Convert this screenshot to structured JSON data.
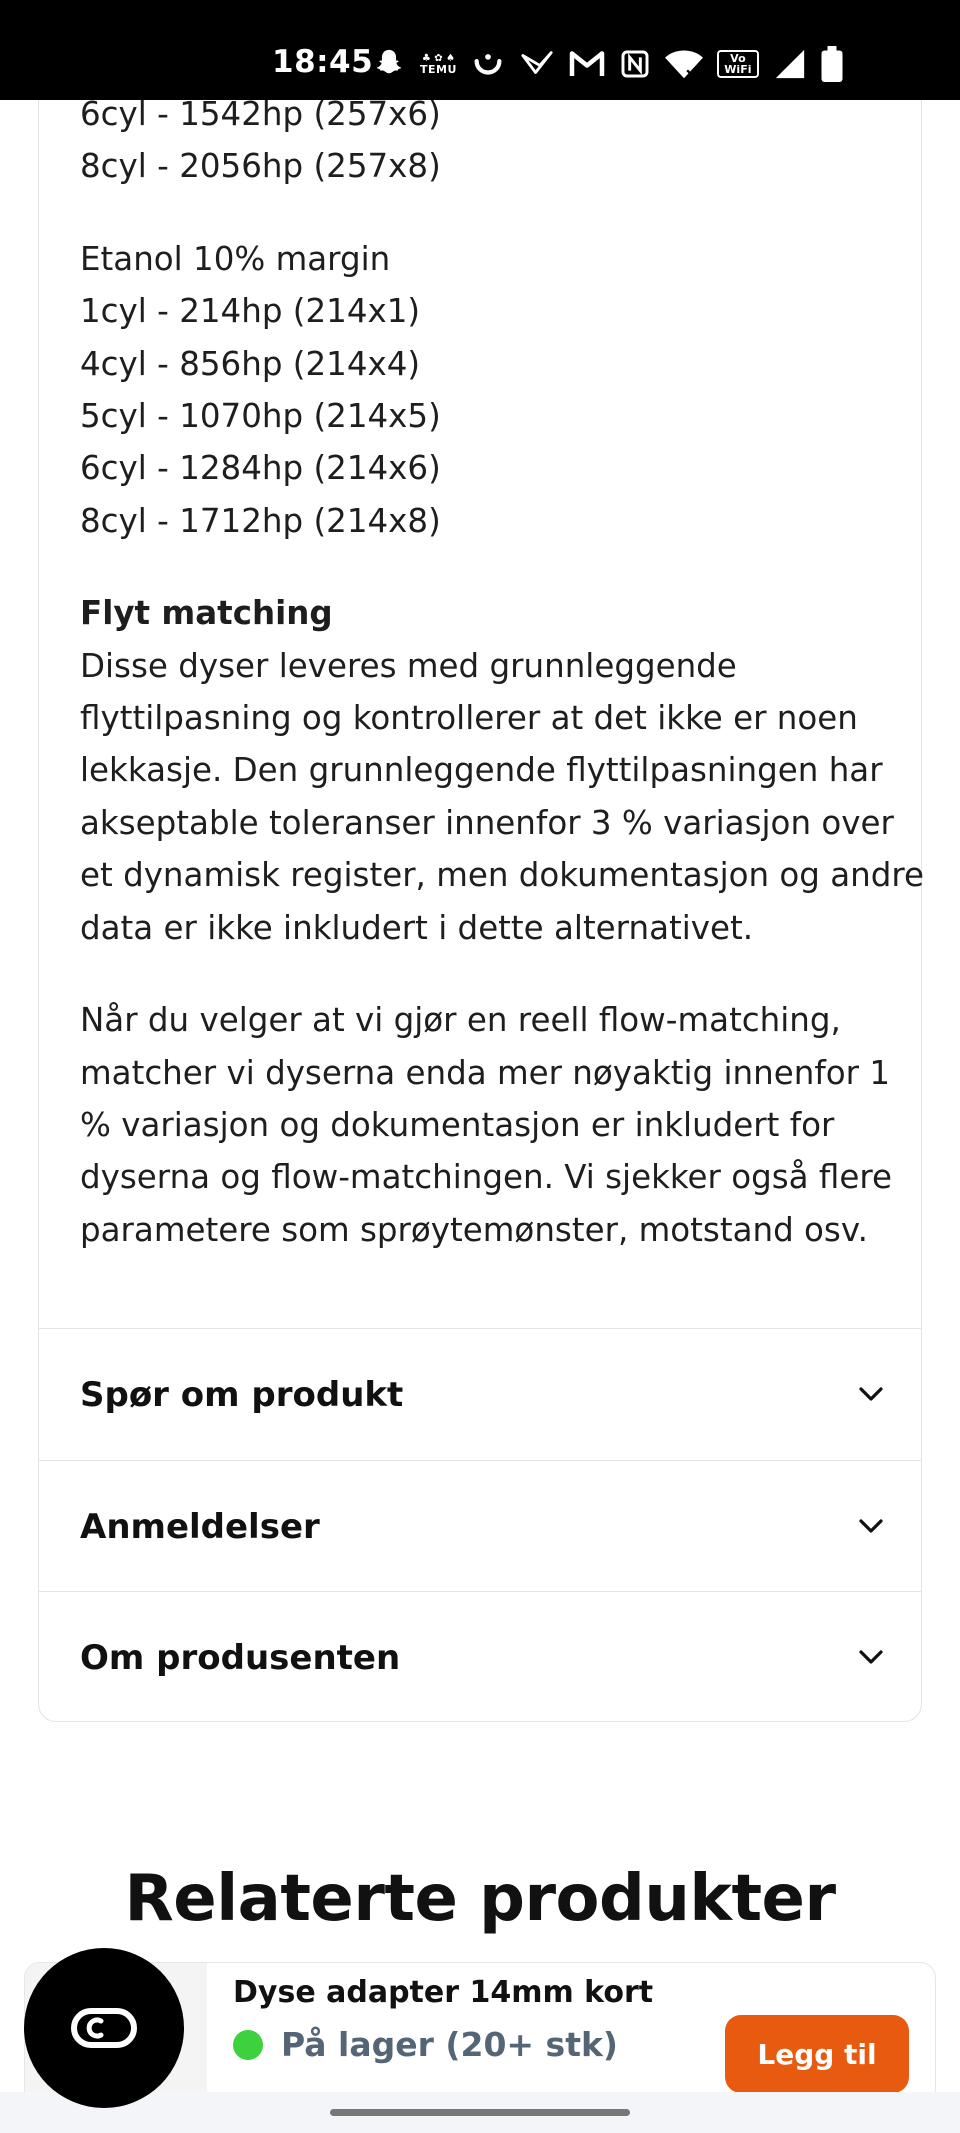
{
  "status_bar": {
    "time": "18:45",
    "icons": [
      "snapchat-icon",
      "temu-icon",
      "smile-app-icon",
      "bird-app-icon",
      "gmail-icon",
      "nfc-icon",
      "wifi-icon",
      "vowifi-icon",
      "cell-signal-icon",
      "battery-icon"
    ],
    "temu_label": "TEMU",
    "vowifi_label": "Vo WiFi"
  },
  "description": {
    "top_line_partial": "6cyl - 1542hp (257x6)",
    "line_8cyl_e85": "8cyl - 2056hp (257x8)",
    "etanol_heading": "Etanol 10% margin",
    "etanol_lines": [
      "1cyl - 214hp (214x1)",
      "4cyl - 856hp (214x4)",
      "5cyl - 1070hp (214x5)",
      "6cyl - 1284hp (214x6)",
      "8cyl - 1712hp (214x8)"
    ],
    "flow_heading": "Flyt matching",
    "flow_paragraph_lines": [
      "Disse dyser leveres med grunnleggende",
      "flyttilpasning og kontrollerer at det ikke er noen",
      "lekkasje. Den grunnleggende flyttilpasningen har",
      "akseptable toleranser innenfor 3 % variasjon over",
      "et dynamisk register, men dokumentasjon og andre",
      "data er ikke inkludert i dette alternativet."
    ],
    "flow_paragraph2_lines": [
      "Når du velger at vi gjør en reell flow-matching,",
      "matcher vi dyserna enda mer nøyaktig innenfor 1",
      "% variasjon og dokumentasjon er inkludert for",
      "dyserna og flow-matchingen. Vi sjekker også flere",
      "parametere som sprøytemønster, motstand osv."
    ]
  },
  "accordions": [
    {
      "label": "Spør om produkt"
    },
    {
      "label": "Anmeldelser"
    },
    {
      "label": "Om produsenten"
    }
  ],
  "related": {
    "title": "Relaterte produkter"
  },
  "sticky_product": {
    "name": "Dyse adapter 14mm kort",
    "stock_text": "På lager (20+ stk)",
    "stock_color": "#3dd13d",
    "button_label": "Legg til",
    "button_color": "#e85a10"
  },
  "chat_button": {
    "icon": "chat-bubble-icon"
  }
}
